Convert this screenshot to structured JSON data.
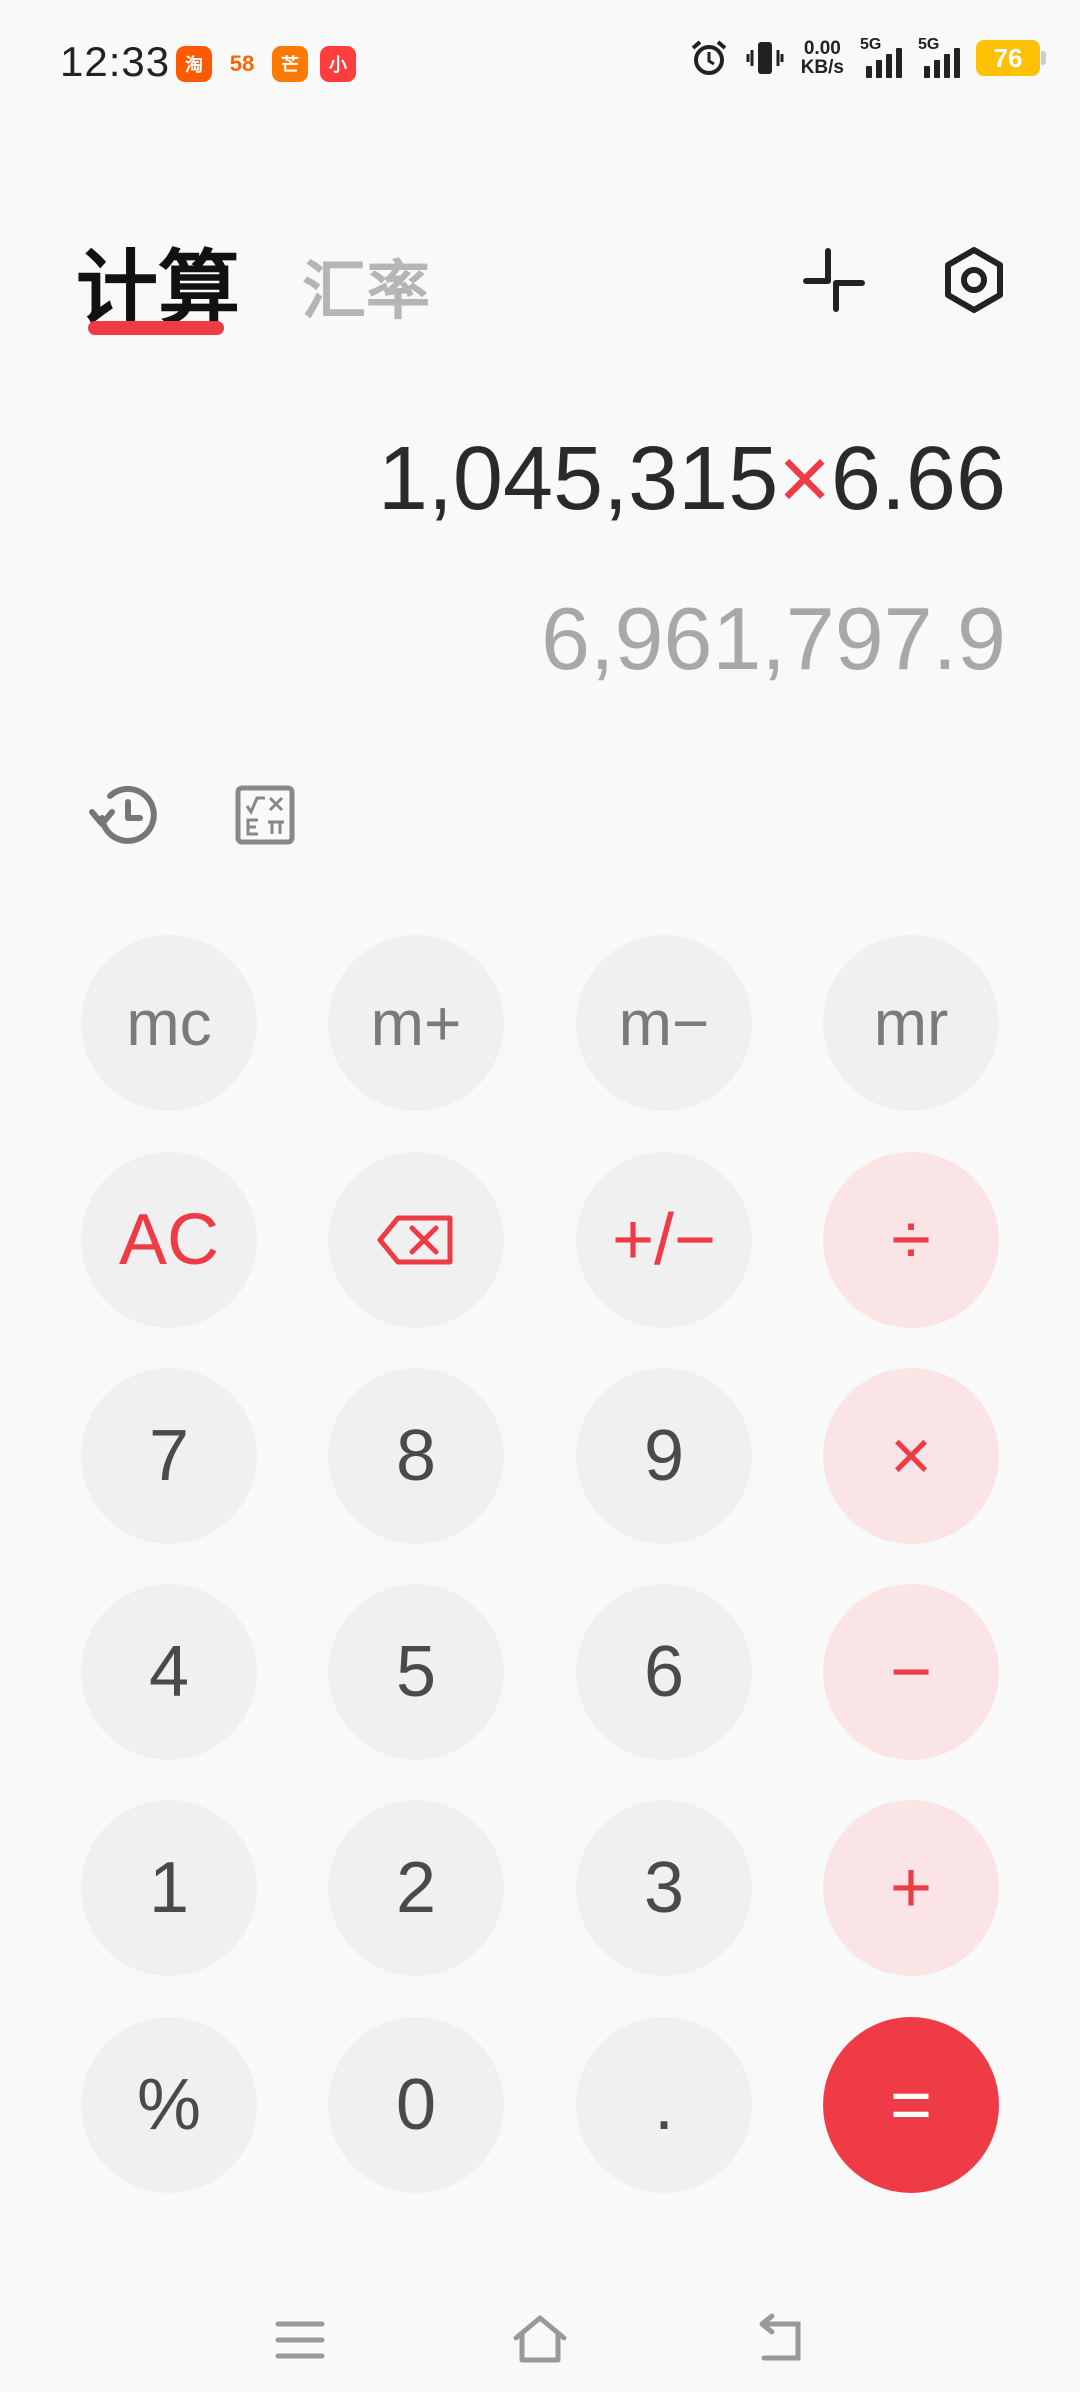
{
  "status_bar": {
    "time": "12:33",
    "app_icons": [
      "淘",
      "58",
      "芒",
      "小"
    ],
    "net_speed_value": "0.00",
    "net_speed_unit": "KB/s",
    "sim1": "5G",
    "sim2": "5G",
    "battery": "76",
    "battery_color": "#ffc107"
  },
  "header": {
    "tab_active": "计算",
    "tab_inactive": "汇率"
  },
  "display": {
    "expression_left": "1,045,315",
    "expression_op": "×",
    "expression_right": "6.66",
    "result": "6,961,797.9"
  },
  "keys": {
    "mc": "mc",
    "m_plus": "m+",
    "m_minus": "m−",
    "mr": "mr",
    "ac": "AC",
    "sign": "+/−",
    "divide": "÷",
    "seven": "7",
    "eight": "8",
    "nine": "9",
    "multiply": "×",
    "four": "4",
    "five": "5",
    "six": "6",
    "minus": "−",
    "one": "1",
    "two": "2",
    "three": "3",
    "plus": "+",
    "percent": "%",
    "zero": "0",
    "dot": ".",
    "equals": "="
  },
  "colors": {
    "accent": "#ef3b46",
    "key_bg": "#f0f0f0",
    "op_bg": "#fbe4e5"
  }
}
